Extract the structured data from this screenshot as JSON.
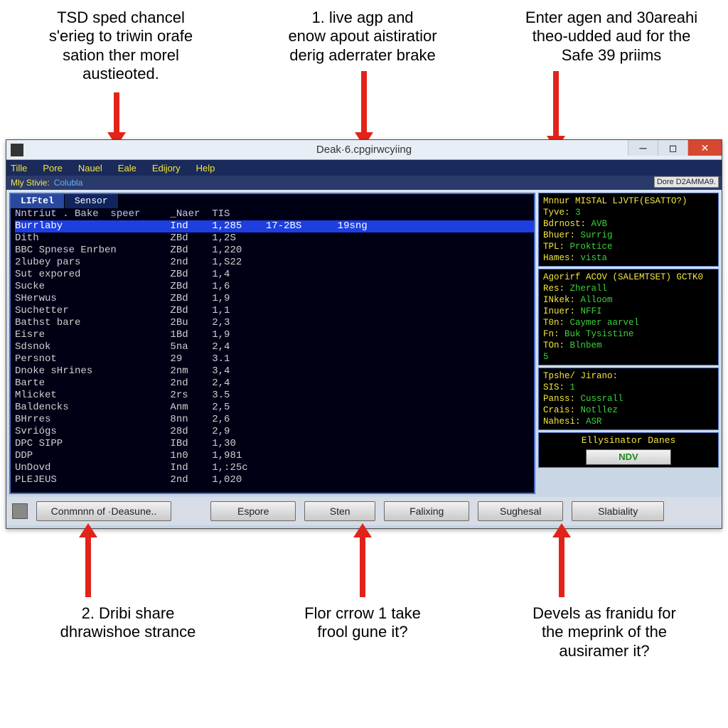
{
  "annotations": {
    "top_left": "TSD sped chancel\ns'erieg to triwin orafe\nsation ther morel\naustieoted.",
    "top_center": "1. live agp and\nenow apout aistiratior\nderig aderrater brake",
    "top_right": "Enter agen and 30areahi\ntheo-udded aud for the\nSafe 39 priims",
    "bot_left": "2. Dribi share\ndhrawishoe strance",
    "bot_center": "Flor crrow 1 take\nfrool gune it?",
    "bot_right": "Devels as franidu for\nthe meprink of the\nausiramer it?"
  },
  "window": {
    "title": "Deak·6.cpgirwcyiing",
    "menu": [
      "Tille",
      "Pore",
      "Nauel",
      "Eale",
      "Edijory",
      "Help"
    ],
    "status_label": "Mly Stivie:",
    "status_value": "Colubla",
    "dore_label": "Dore",
    "dore_value": "D2AMMA9.",
    "tabs": [
      "LIFtel",
      "Sensor"
    ],
    "header_line": "Nntriut . Bake  speer     _Naer  TIS",
    "rows": [
      {
        "c0": "Burrlaby",
        "c1": "Ind",
        "c2": "1,285",
        "c3": "17-2BS",
        "c4": "19sng",
        "sel": true
      },
      {
        "c0": "Dith",
        "c1": "ZBd",
        "c2": "1,2S"
      },
      {
        "c0": "BBC Spnese Enrben",
        "c1": "ZBd",
        "c2": "1,220"
      },
      {
        "c0": "2lubey pars",
        "c1": "2nd",
        "c2": "1,S22"
      },
      {
        "c0": "Sut expored",
        "c1": "ZBd",
        "c2": "1,4"
      },
      {
        "c0": "Sucke",
        "c1": "ZBd",
        "c2": "1,6"
      },
      {
        "c0": "SHerwus",
        "c1": "ZBd",
        "c2": "1,9"
      },
      {
        "c0": "Suchetter",
        "c1": "ZBd",
        "c2": "1,1"
      },
      {
        "c0": "Bathst bare",
        "c1": "2Bu",
        "c2": "2,3"
      },
      {
        "c0": "Eisre",
        "c1": "1Bd",
        "c2": "1,9"
      },
      {
        "c0": "Sdsnok",
        "c1": "5na",
        "c2": "2,4"
      },
      {
        "c0": "Persnot",
        "c1": "29",
        "c2": "3.1"
      },
      {
        "c0": "Dnoke sHrines",
        "c1": "2nm",
        "c2": "3,4"
      },
      {
        "c0": "Barte",
        "c1": "2nd",
        "c2": "2,4"
      },
      {
        "c0": "Mlicket",
        "c1": "2rs",
        "c2": "3.5"
      },
      {
        "c0": "Baldencks",
        "c1": "Anm",
        "c2": "2,5"
      },
      {
        "c0": "BHrres",
        "c1": "8nn",
        "c2": "2,6"
      },
      {
        "c0": "Svriógs",
        "c1": "28d",
        "c2": "2,9"
      },
      {
        "c0": "DPC SIPP",
        "c1": "IBd",
        "c2": "1,30"
      },
      {
        "c0": "DDP",
        "c1": "1n0",
        "c2": "1,981"
      },
      {
        "c0": "UnDovd",
        "c1": "Ind",
        "c2": "1,:25c"
      },
      {
        "c0": "PLEJEUS",
        "c1": "2nd",
        "c2": "1,020"
      }
    ],
    "side": {
      "box1": {
        "title": "Mnnur MISTAL LJVTF(ESATTO?)",
        "kv": [
          [
            "Tyve",
            "3"
          ],
          [
            "Bdrnost",
            "AVB"
          ],
          [
            "Bhuer",
            "Surrig"
          ],
          [
            "TPL",
            "Proktice"
          ],
          [
            "Hames",
            "vista"
          ]
        ]
      },
      "box2": {
        "title": "Agorirf ACOV (SALEMTSET) GCTK0",
        "kv": [
          [
            "Res",
            "Zherall"
          ],
          [
            "INkek",
            "Alloom"
          ],
          [
            "Inuer",
            "NFFI"
          ],
          [
            "T0n",
            "Caymer aarvel"
          ],
          [
            "Fn",
            "Buk Tysistine"
          ],
          [
            "TOn",
            "Blnbem"
          ]
        ],
        "extra": "5"
      },
      "box3": {
        "title": "Tpshe/\nJirano:",
        "kv": [
          [
            "SIS",
            "1"
          ],
          [
            "Panss",
            "Cussrall"
          ],
          [
            "Crais",
            "Notllez"
          ],
          [
            "Nahesi",
            "ASR"
          ]
        ]
      },
      "ndv": {
        "title": "Ellysinator Danes",
        "button": "NDV"
      }
    },
    "bottom_buttons": [
      "Conmnnn of ·Deasune..",
      "Espore",
      "Sten",
      "Falixing",
      "Sughesal",
      "Slabiality"
    ]
  }
}
